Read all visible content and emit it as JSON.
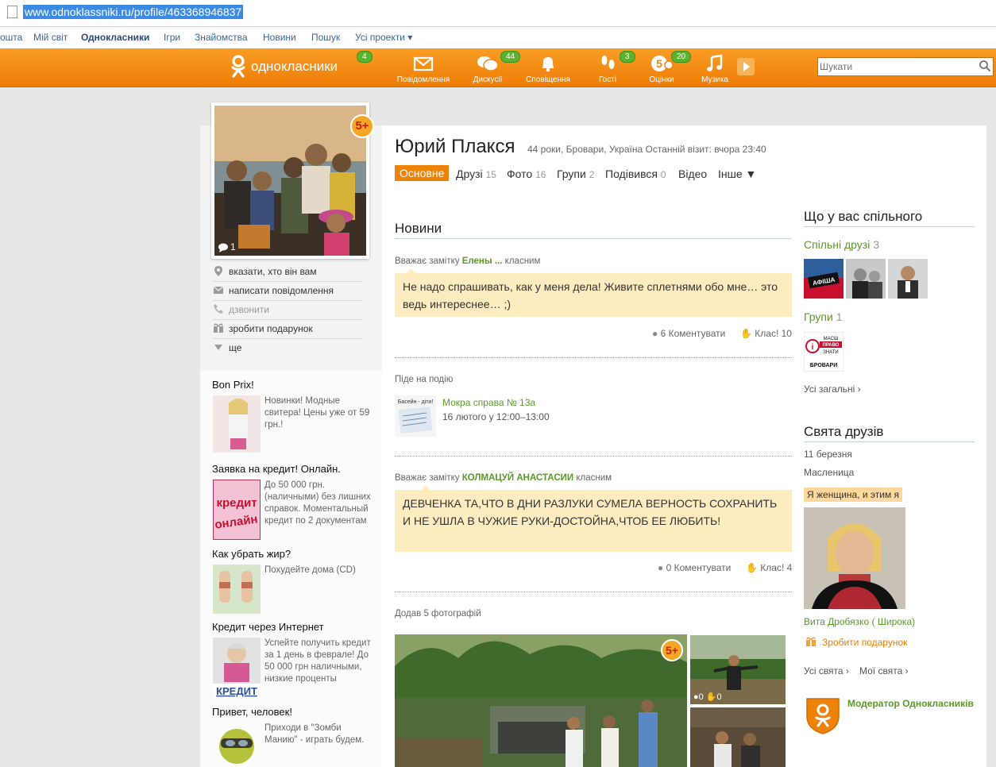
{
  "browser": {
    "url": "www.odnoklassniki.ru/profile/463368946837"
  },
  "projects_nav": {
    "items": [
      "ошта",
      "Мій світ",
      "Однокласники",
      "Ігри",
      "Знайомства",
      "Новини",
      "Пошук",
      "Усі проекти ▾"
    ],
    "active": "Однокласники"
  },
  "toolbar": {
    "logo": "однокласники",
    "logo_badge": "4",
    "items": [
      {
        "label": "Повідомлення",
        "icon": "envelope-icon",
        "badge": ""
      },
      {
        "label": "Дискусії",
        "icon": "chat-bubbles-icon",
        "badge": "44"
      },
      {
        "label": "Сповіщення",
        "icon": "bell-icon",
        "badge": ""
      },
      {
        "label": "Гості",
        "icon": "footprints-icon",
        "badge": "3"
      },
      {
        "label": "Оцінки",
        "icon": "rating-5-icon",
        "badge": "20"
      },
      {
        "label": "Музика",
        "icon": "music-note-icon",
        "badge": ""
      }
    ],
    "search_placeholder": "Шукати",
    "colors": {
      "bar": "#f28a12",
      "badge": "#5cb22e"
    }
  },
  "avatar": {
    "rating_badge": "5+",
    "comments": "1"
  },
  "actions": [
    {
      "label": "вказати, хто він вам",
      "icon": "pin-icon"
    },
    {
      "label": "написати повідомлення",
      "icon": "envelope-icon"
    },
    {
      "label": "дзвонити",
      "icon": "phone-icon"
    },
    {
      "label": "зробити подарунок",
      "icon": "gift-icon"
    },
    {
      "label": "ще",
      "icon": "triangle-down-icon"
    }
  ],
  "ads": [
    {
      "title": "Bon Prix!",
      "text": "Новинки! Модные свитера! Цены уже от 59 грн.!"
    },
    {
      "title": "Заявка на кредит! Онлайн.",
      "text": "До 50 000 грн. (наличными) без лишних справок. Моментальный кредит по 2 документам",
      "img_lines": [
        "кредит",
        "онлайн"
      ]
    },
    {
      "title": "Как убрать жир?",
      "text": "Похудейте дома (CD)"
    },
    {
      "title": "Кредит через Интернет",
      "text": "Успейте получить кредит за 1 день в феврале! До 50 000 грн наличными, низкие проценты",
      "img_caption": "КРЕДИТ"
    },
    {
      "title": "Привет, человек!",
      "text": "Приходи в \"Зомби Манию\" - играть будем."
    }
  ],
  "profile": {
    "name": "Юрий Плакся",
    "meta": "44 роки, Бровари, Україна  Останній візит: вчора 23:40",
    "tabs": [
      {
        "label": "Основне",
        "count": ""
      },
      {
        "label": "Друзі",
        "count": "15"
      },
      {
        "label": "Фото",
        "count": "16"
      },
      {
        "label": "Групи",
        "count": "2"
      },
      {
        "label": "Подівився",
        "count": "0"
      },
      {
        "label": "Відео",
        "count": ""
      },
      {
        "label": "Інше ▼",
        "count": ""
      }
    ]
  },
  "news": {
    "title": "Новини",
    "item1": {
      "prefix": "Вважає замітку ",
      "author": "Елены ...",
      "suffix": " класним",
      "text": "Не надо спрашивать, как у меня дела! Живите сплетнями обо мне… это ведь интереснее… ;)",
      "comments": "6 Коментувати",
      "likes": "Клас! 10"
    },
    "item2": {
      "label": "Піде на подію",
      "event_title": "Мокра справа № 13а",
      "event_time": "16 лютого у 12:00–13:00",
      "thumb_text": "Басейн - діти!"
    },
    "item3": {
      "prefix": "Вважає замітку ",
      "author": "КОЛМАЦУЙ АНАСТАСИИ",
      "suffix": " класним",
      "text": "ДЕВЧЕНКА ТА,ЧТО В ДНИ РАЗЛУКИ СУМЕЛА ВЕРНОСТЬ СОХРАНИТЬ И НЕ УШЛА В ЧУЖИЕ РУКИ-ДОСТОЙНА,ЧТОБ ЕЕ ЛЮБИТЬ!",
      "comments": "0 Коментувати",
      "likes": "Клас! 4"
    },
    "item4": {
      "label": "Додав 5 фотографій",
      "badge": "5+",
      "small_comments": "0",
      "small_likes": "0"
    }
  },
  "common": {
    "title": "Що у вас спільного",
    "friends_label": "Спільні друзі",
    "friends_count": "3",
    "groups_label": "Групи",
    "groups_count": "1",
    "all_common": "Усі загальні ›",
    "group_logo_lines": [
      "МАСШ",
      "ПРАВО",
      "ЗНАТИ",
      "БРОВАРИ"
    ],
    "friend_poster": "АФІША"
  },
  "holidays": {
    "title": "Свята друзів",
    "date": "11 березня",
    "holiday": "Масленица",
    "status": "Я женщина, и этим я",
    "friend": "Вита Дробязко ( Широка)",
    "gift": "Зробити подарунок",
    "all": "Усі свята ›",
    "mine": "Мої свята ›"
  },
  "moderator": {
    "label": "Модератор Однокласників"
  }
}
